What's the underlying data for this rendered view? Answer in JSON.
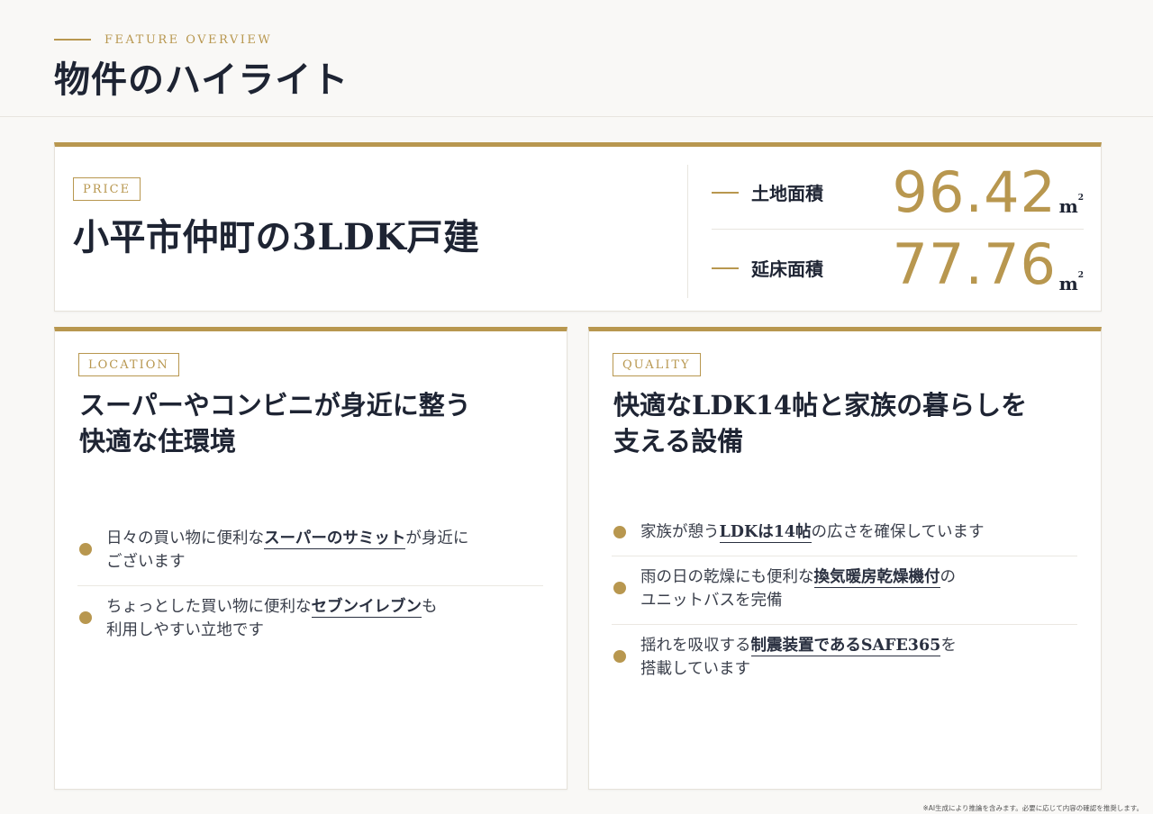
{
  "header": {
    "eyebrow": "FEATURE OVERVIEW",
    "title": "物件のハイライト"
  },
  "price_card": {
    "tag": "PRICE",
    "title": "小平市仲町の3LDK戸建",
    "stats": [
      {
        "label": "土地面積",
        "value": "96.42",
        "unit": "m",
        "unit_sup": "2"
      },
      {
        "label": "延床面積",
        "value": "77.76",
        "unit": "m",
        "unit_sup": "2"
      }
    ]
  },
  "location_card": {
    "tag": "LOCATION",
    "heading_line1": "スーパーやコンビニが身近に整う",
    "heading_line2": "快適な住環境",
    "points": [
      {
        "pre": "日々の買い物に便利な",
        "highlight": "スーパーのサミット",
        "post1": "が身近に",
        "post2": "ございます"
      },
      {
        "pre": "ちょっとした買い物に便利な",
        "highlight": "セブンイレブン",
        "post1": "も",
        "post2": "利用しやすい立地です"
      }
    ]
  },
  "quality_card": {
    "tag": "QUALITY",
    "heading_line1": "快適なLDK14帖と家族の暮らしを",
    "heading_line2": "支える設備",
    "points": [
      {
        "pre": "家族が憩う",
        "highlight": "LDKは14帖",
        "post1": "の広さを確保しています",
        "post2": ""
      },
      {
        "pre": "雨の日の乾燥にも便利な",
        "highlight": "換気暖房乾燥機付",
        "post1": "の",
        "post2": "ユニットバスを完備"
      },
      {
        "pre": "揺れを吸収する",
        "highlight": "制震装置であるSAFE365",
        "post1": "を",
        "post2": "搭載しています"
      }
    ]
  },
  "footer_note": "※AI生成により推論を含みます。必要に応じて内容の確認を推奨します。",
  "colors": {
    "accent": "#b8974f",
    "text": "#1e2433",
    "background": "#f9f8f6"
  }
}
